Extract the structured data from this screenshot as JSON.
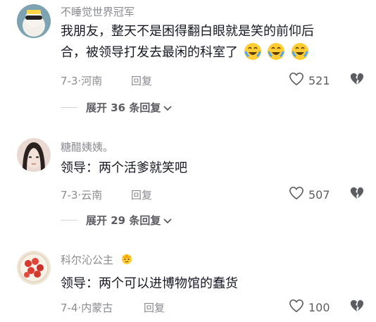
{
  "comments": [
    {
      "username": "不睡觉世界冠军",
      "text_line1": "我朋友，整天不是困得翻白眼就是笑的前仰后",
      "text_line2": "合，被领导打发去最闲的科室了",
      "emoji": "laughing-crying-emoji",
      "date": "7-3",
      "location": "河南",
      "reply_label": "回复",
      "likes": "521",
      "expand_label": "展开 36 条回复"
    },
    {
      "username": "糖醋姨姨。",
      "text": "领导：两个活爹就笑吧",
      "date": "7-3",
      "location": "云南",
      "reply_label": "回复",
      "likes": "507",
      "expand_label": "展开 29 条回复"
    },
    {
      "username": "科尔沁公主",
      "badge": "crown-emoji",
      "text": "领导：两个可以进博物馆的蠢货",
      "date": "7-4",
      "location": "内蒙古",
      "reply_label": "回复",
      "likes": "100"
    }
  ],
  "colors": {
    "primary_text": "#161823",
    "secondary_text": "#8a8b91",
    "icon": "#5c5d63"
  }
}
